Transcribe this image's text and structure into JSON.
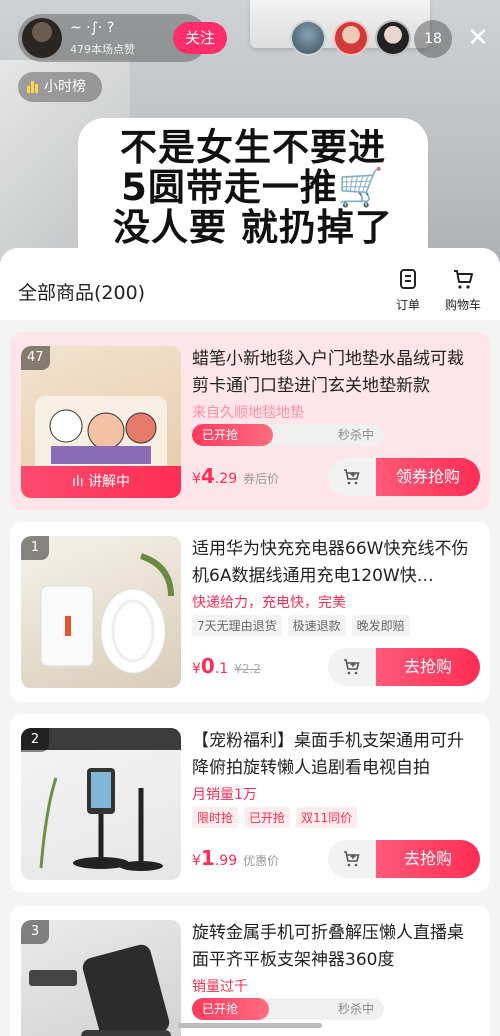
{
  "host": {
    "name": "~ ·∫· ?",
    "likes": "479本场点赞",
    "follow_label": "关注"
  },
  "viewers": {
    "count": "18"
  },
  "rank": {
    "label": "小时榜"
  },
  "sign": {
    "lines": [
      "不是女生不要进",
      "5圆带走一推🛒",
      "没人要 就扔掉了"
    ]
  },
  "panel": {
    "title": "全部商品(200)",
    "orders_label": "订单",
    "cart_label": "购物车"
  },
  "products": [
    {
      "rank": "47",
      "title": "蜡笔小新地毯入户门地垫水晶绒可裁剪卡通门口垫进门玄关地垫新款",
      "subtitle": "来自久顺地毯地垫",
      "progress_left": "已开抢",
      "progress_right": "秒杀中",
      "progress_fill": 0.42,
      "price_symbol": "¥",
      "price_int": "4",
      "price_dec": ".29",
      "price_note": "券后价",
      "buy_label": "领券抢购",
      "live_label": "讲解中"
    },
    {
      "rank": "1",
      "title": "适用华为快充充电器66W快充线不伤机6A数据线通用充电120W快…",
      "subtitle": "快递给力，充电快，完美",
      "tags": [
        "7天无理由退货",
        "极速退款",
        "晚发即赔"
      ],
      "price_symbol": "¥",
      "price_int": "0",
      "price_dec": ".1",
      "price_strike": "¥2.2",
      "buy_label": "去抢购"
    },
    {
      "rank": "2",
      "title": "【宠粉福利】桌面手机支架通用可升降俯拍旋转懒人追剧看电视自拍",
      "subtitle": "月销量1万",
      "tags": [
        "限时抢",
        "已开抢",
        "双11同价"
      ],
      "price_symbol": "¥",
      "price_int": "1",
      "price_dec": ".99",
      "price_note": "优惠价",
      "buy_label": "去抢购"
    },
    {
      "rank": "3",
      "title": "旋转金属手机可折叠解压懒人直播桌面平齐平板支架神器360度",
      "subtitle": "销量过千",
      "progress_left": "已开抢",
      "progress_right": "秒杀中",
      "progress_fill": 0.4
    }
  ],
  "colors": {
    "accent": "#ff2d55",
    "follow": "#ff2d6b",
    "active_card": "#fde5e9"
  }
}
